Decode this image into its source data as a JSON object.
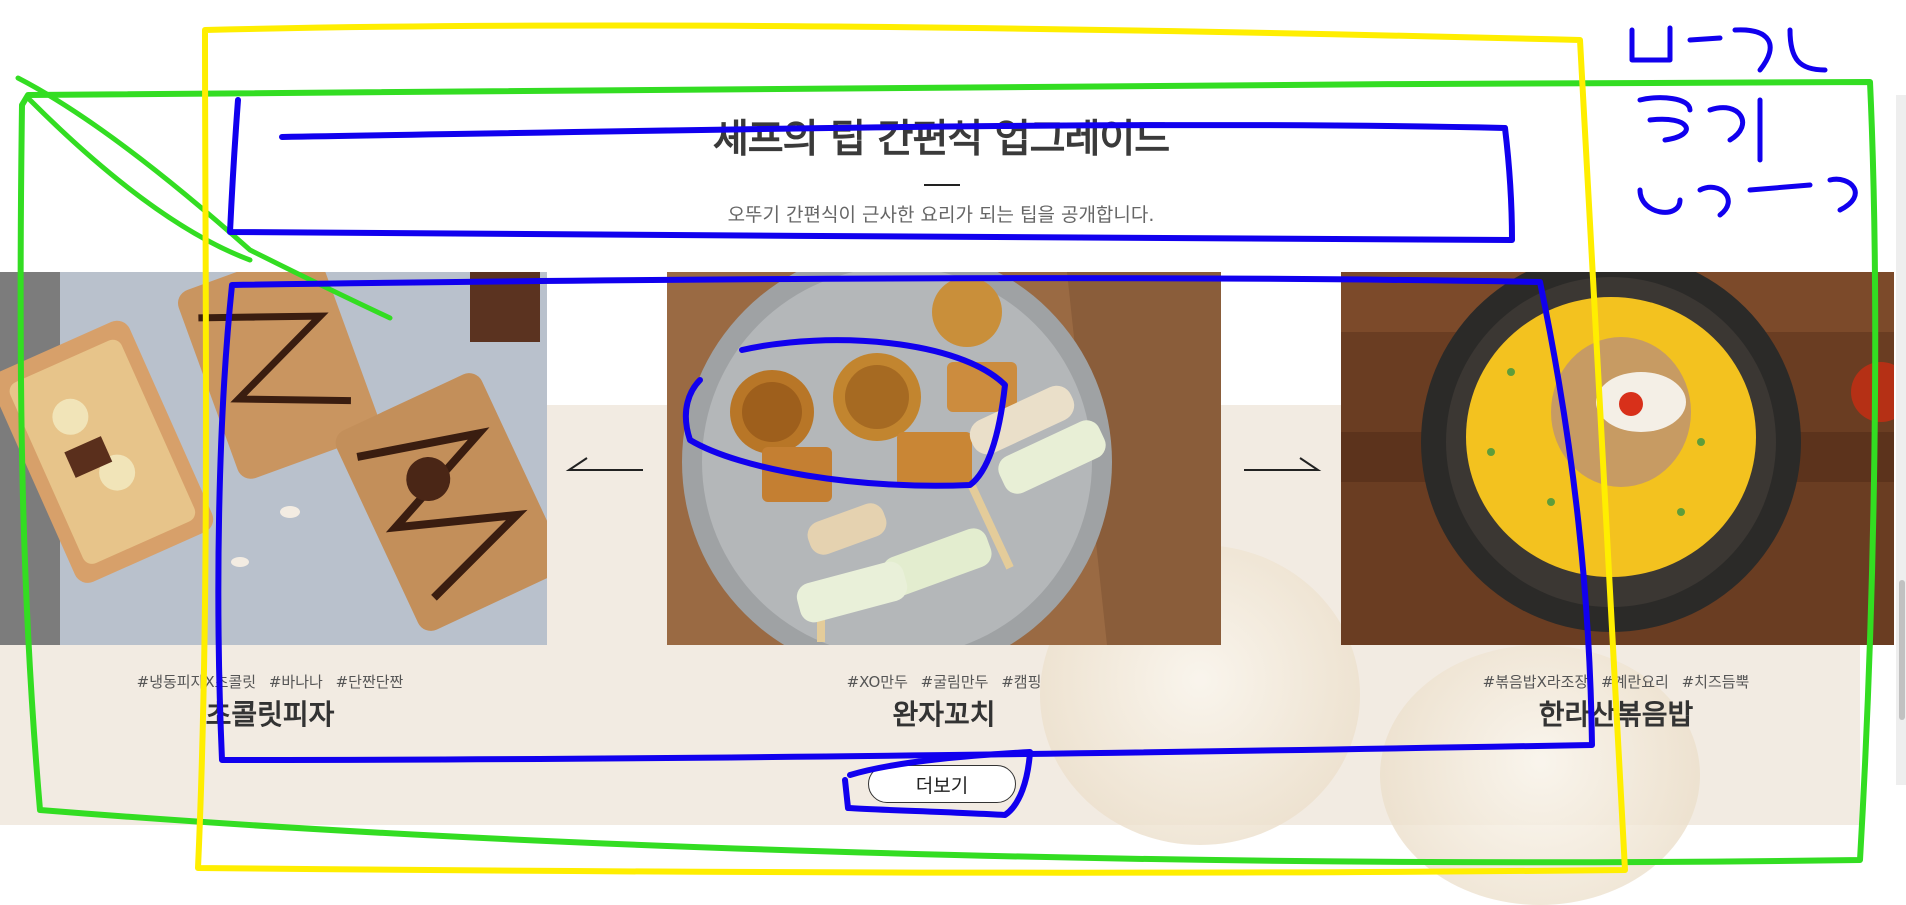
{
  "section": {
    "title": "셰프의 팁 간편식 업그레이드",
    "subtitle": "오뚜기 간편식이 근사한 요리가 되는 팁을 공개합니다."
  },
  "cards": [
    {
      "tags": "#냉동피자X초콜릿 #바나나 #단짠단짠",
      "title": "초콜릿피자"
    },
    {
      "tags": "#XO만두 #굴림만두 #캠핑",
      "title": "완자꼬치"
    },
    {
      "tags": "#볶음밥X라조장 #계란요리 #치즈듬뿍",
      "title": "한라산볶음밥"
    }
  ],
  "carousel": {
    "prev_icon": "arrow-left-icon",
    "next_icon": "arrow-right-icon"
  },
  "more_button": {
    "label": "더보기"
  },
  "annotation": {
    "note": "배경은 초록색 box까지",
    "colors": {
      "green": "#33dd22",
      "yellow": "#ffee00",
      "blue": "#1100ee"
    }
  }
}
